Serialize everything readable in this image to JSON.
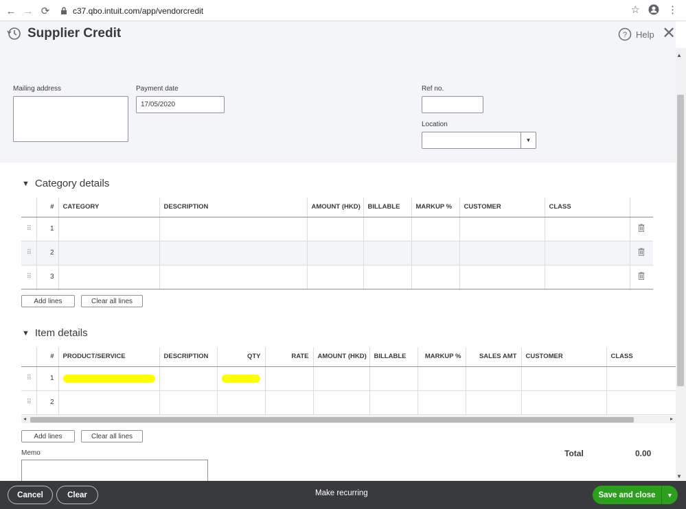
{
  "browser": {
    "url": "c37.qbo.intuit.com/app/vendorcredit",
    "back_icon": "←",
    "forward_icon": "→",
    "reload_icon": "⟳",
    "lock_icon": "🔒",
    "star_icon": "☆",
    "menu_icon": "⋮"
  },
  "header": {
    "title": "Supplier Credit",
    "help_label": "Help",
    "close_icon": "✕"
  },
  "form": {
    "mailing_address_label": "Mailing address",
    "payment_date_label": "Payment date",
    "payment_date_value": "17/05/2020",
    "ref_no_label": "Ref no.",
    "location_label": "Location"
  },
  "category_section": {
    "title": "Category details",
    "columns": [
      "#",
      "CATEGORY",
      "DESCRIPTION",
      "AMOUNT (HKD)",
      "BILLABLE",
      "MARKUP %",
      "CUSTOMER",
      "CLASS"
    ],
    "rows": [
      "1",
      "2",
      "3"
    ],
    "add_lines": "Add lines",
    "clear_lines": "Clear all lines"
  },
  "item_section": {
    "title": "Item details",
    "columns": [
      "#",
      "PRODUCT/SERVICE",
      "DESCRIPTION",
      "QTY",
      "RATE",
      "AMOUNT (HKD)",
      "BILLABLE",
      "MARKUP %",
      "SALES AMT",
      "CUSTOMER",
      "CLASS"
    ],
    "rows": [
      "1",
      "2"
    ],
    "add_lines": "Add lines",
    "clear_lines": "Clear all lines",
    "highlight_color": "#ffff00"
  },
  "memo_label": "Memo",
  "total": {
    "label": "Total",
    "value": "0.00"
  },
  "footer": {
    "cancel": "Cancel",
    "clear": "Clear",
    "make_recurring": "Make recurring",
    "save_and_close": "Save and close",
    "accent": "#2ca01c"
  }
}
